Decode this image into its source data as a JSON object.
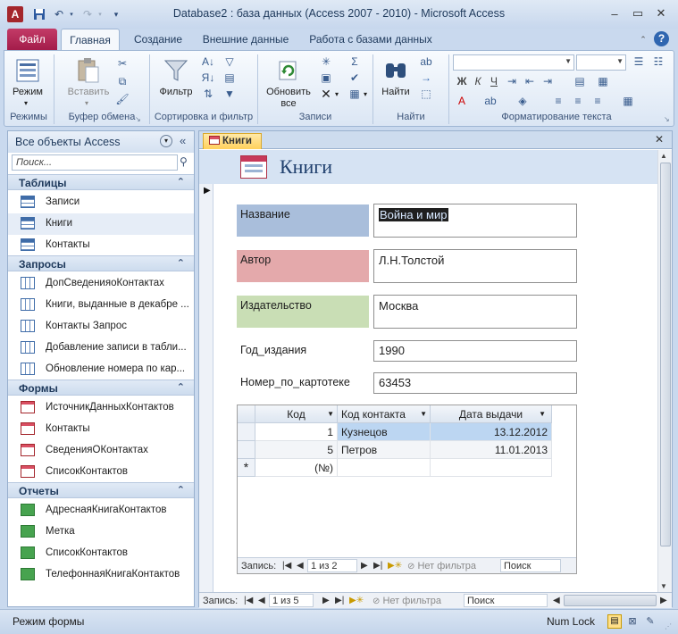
{
  "window": {
    "title": "Database2 : база данных (Access 2007 - 2010)  -  Microsoft Access",
    "app_letter": "A"
  },
  "tabs": [
    "Файл",
    "Главная",
    "Создание",
    "Внешние данные",
    "Работа с базами данных"
  ],
  "ribbon": {
    "groups": [
      "Режимы",
      "Буфер обмена",
      "Сортировка и фильтр",
      "Записи",
      "Найти",
      "Форматирование текста"
    ],
    "buttons": {
      "mode": "Режим",
      "paste": "Вставить",
      "filter": "Фильтр",
      "refresh": "Обновить",
      "refresh_sub": "все",
      "find": "Найти"
    }
  },
  "nav": {
    "title": "Все объекты Access",
    "search_placeholder": "Поиск...",
    "groups": [
      {
        "name": "Таблицы",
        "items": [
          "Записи",
          "Книги",
          "Контакты"
        ]
      },
      {
        "name": "Запросы",
        "items": [
          "ДопСведенияоКонтактах",
          "Книги, выданные в декабре ...",
          "Контакты Запрос",
          "Добавление записи в табли...",
          "Обновление номера по кар..."
        ]
      },
      {
        "name": "Формы",
        "items": [
          "ИсточникДанныхКонтактов",
          "Контакты",
          "СведенияОКонтактах",
          "СписокКонтактов"
        ]
      },
      {
        "name": "Отчеты",
        "items": [
          "АдреснаяКнигаКонтактов",
          "Метка",
          "СписокКонтактов",
          "ТелефоннаяКнигаКонтактов"
        ]
      }
    ]
  },
  "document": {
    "tab_label": "Книги",
    "form_title": "Книги",
    "fields": [
      {
        "label": "Название",
        "value": "Война и мир"
      },
      {
        "label": "Автор",
        "value": "Л.Н.Толстой"
      },
      {
        "label": "Издательство",
        "value": "Москва"
      },
      {
        "label": "Год_издания",
        "value": "1990"
      },
      {
        "label": "Номер_по_картотеке",
        "value": "63453"
      }
    ],
    "subform": {
      "columns": [
        "Код",
        "Код контакта",
        "Дата выдачи"
      ],
      "rows": [
        [
          "1",
          "Кузнецов",
          "13.12.2012"
        ],
        [
          "5",
          "Петров",
          "11.01.2013"
        ]
      ],
      "new_row": "(№)",
      "nav_label": "Запись:",
      "nav_position": "1 из 2",
      "nav_filter": "Нет фильтра",
      "nav_search": "Поиск"
    },
    "nav_label": "Запись:",
    "nav_position": "1 из 5",
    "nav_filter": "Нет фильтра",
    "nav_search": "Поиск"
  },
  "status": {
    "left": "Режим формы",
    "numlock": "Num Lock"
  }
}
